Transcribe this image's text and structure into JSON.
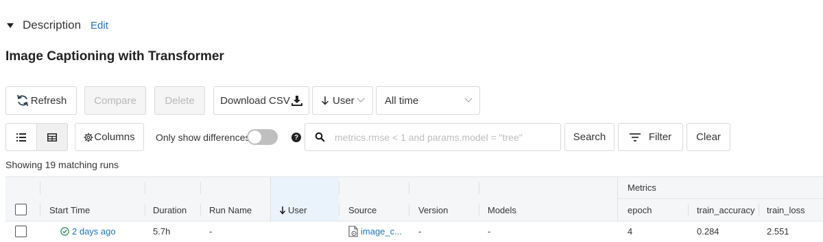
{
  "description": {
    "label": "Description",
    "edit_label": "Edit"
  },
  "experiment": {
    "title": "Image Captioning with Transformer"
  },
  "toolbar": {
    "refresh_label": "Refresh",
    "compare_label": "Compare",
    "delete_label": "Delete",
    "download_label": "Download CSV",
    "sort_select": "User",
    "time_select": "All time"
  },
  "view": {
    "columns_label": "Columns",
    "only_diff_label": "Only show differences",
    "only_diff_enabled": false,
    "help_glyph": "?"
  },
  "search": {
    "placeholder": "metrics.rmse < 1 and params.model = \"tree\"",
    "search_label": "Search",
    "filter_label": "Filter",
    "clear_label": "Clear"
  },
  "results": {
    "showing_text": "Showing 19 matching runs"
  },
  "table": {
    "group_header": "Metrics",
    "columns": {
      "start_time": "Start Time",
      "duration": "Duration",
      "run_name": "Run Name",
      "user": "User",
      "source": "Source",
      "version": "Version",
      "models": "Models",
      "epoch": "epoch",
      "train_accuracy": "train_accuracy",
      "train_loss": "train_loss"
    },
    "rows": [
      {
        "start_time": "2 days ago",
        "duration": "5.7h",
        "run_name": "-",
        "user": "",
        "source": "image_c...",
        "version": "-",
        "models": "-",
        "epoch": "4",
        "train_accuracy": "0.284",
        "train_loss": "2.551"
      }
    ]
  },
  "icons": {
    "refresh": "refresh-icon",
    "download": "download-icon",
    "sort_arrow": "arrow-down-icon",
    "list_view": "list-icon",
    "table_view": "table-icon",
    "columns": "gear-icon",
    "search": "search-icon",
    "filter": "filter-icon",
    "status": "check-circle-icon",
    "source": "notebook-icon"
  },
  "colors": {
    "link": "#2374bb",
    "status_ok": "#2e8b57",
    "header_bg": "#f4f6f8",
    "selected_header": "#eaf3fb"
  }
}
